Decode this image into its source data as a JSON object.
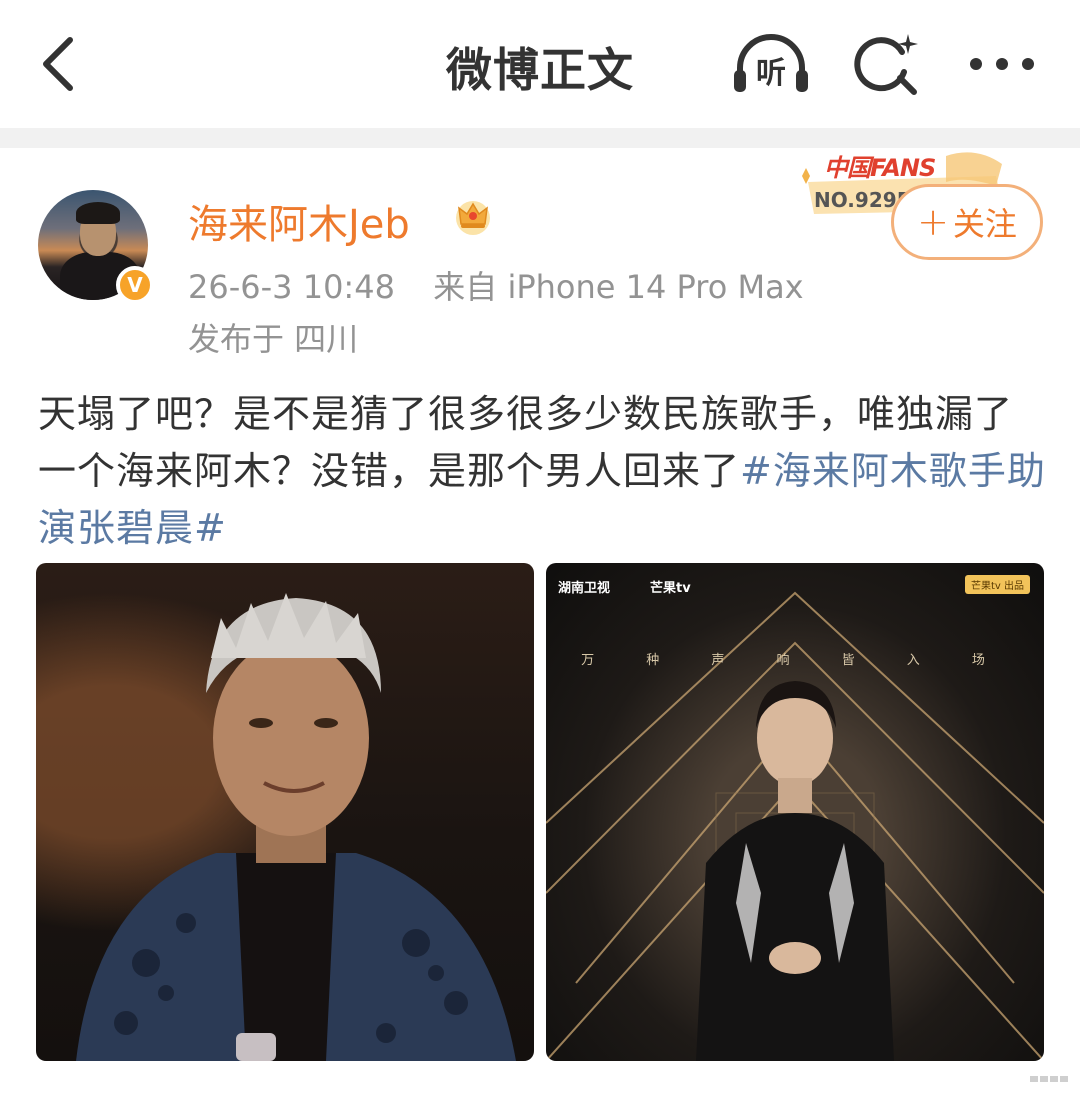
{
  "header": {
    "title": "微博正文",
    "listen_label": "听"
  },
  "author": {
    "name": "海来阿木Jeb",
    "verified_mark": "V",
    "time": "26-6-3 10:48",
    "source": "来自 iPhone 14 Pro Max",
    "location": "发布于 四川",
    "fans_badge": {
      "title": "中国FANS",
      "number": "NO.92951"
    },
    "follow_label": "关注",
    "follow_plus": "+"
  },
  "post": {
    "text": "天塌了吧？是不是猜了很多很多少数民族歌手，唯独漏了一个海来阿木？没错，是那个男人回来了",
    "hashtag": "#海来阿木歌手助演张碧晨#"
  },
  "images": [
    {
      "alt": "海来阿木舞台照"
    },
    {
      "logo_left": "湖南卫视",
      "logo_mid": "芒果tv",
      "logo_right": "芒果tv 出品",
      "caption": "万 种 声 响 皆 入 场"
    }
  ],
  "colors": {
    "accent": "#ee7a2d",
    "hashtag": "#5b7aa3",
    "meta": "#939393",
    "badge": "#f7a329"
  }
}
